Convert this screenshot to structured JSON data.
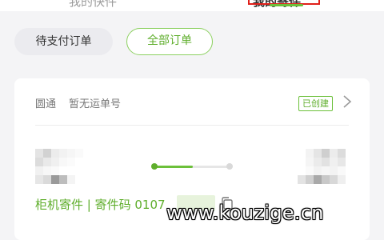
{
  "top_tabs": {
    "left": "我的快件",
    "right": "我的寄件"
  },
  "filters": {
    "pending": "待支付订单",
    "all": "全部订单"
  },
  "order": {
    "carrier": "圆通",
    "waybill": "暂无运单号",
    "status": "已创建",
    "pickup_label": "柜机寄件 | 寄件码 0107",
    "progress": 0.5
  },
  "watermark": "www.kouzige.cn",
  "colors": {
    "accent": "#5fae2c",
    "accent_light": "#8cd060",
    "highlight": "#e0201a"
  },
  "icons": {
    "chevron": "chevron-right-icon",
    "copy": "copy-icon"
  }
}
